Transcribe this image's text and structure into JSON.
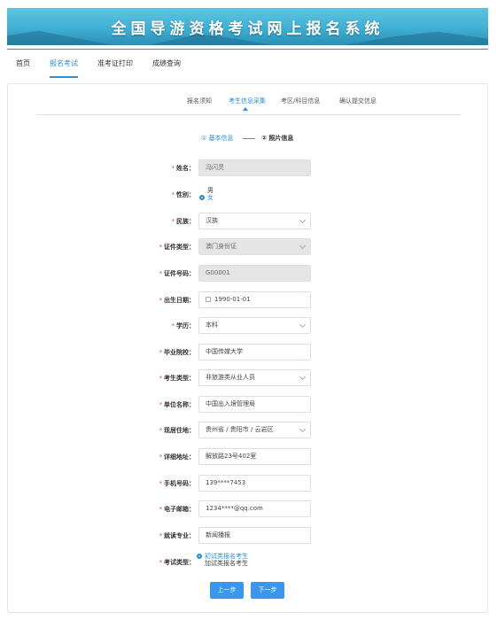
{
  "banner": {
    "title": "全国导游资格考试网上报名系统"
  },
  "topnav": [
    "首页",
    "报名考试",
    "准考证打印",
    "成绩查询"
  ],
  "steptabs": [
    "报名须知",
    "考生信息采集",
    "考区/科目信息",
    "确认提交信息"
  ],
  "substeps": {
    "step1": "① 基本信息",
    "step2": "② 照片信息"
  },
  "form": {
    "name": {
      "label": "姓名：",
      "value": "冯闪灵"
    },
    "gender": {
      "label": "性别：",
      "options": [
        "男",
        "女"
      ]
    },
    "ethnicity": {
      "label": "民族：",
      "value": "汉族"
    },
    "id_type": {
      "label": "证件类型：",
      "value": "澳门身份证"
    },
    "id_number": {
      "label": "证件号码：",
      "value": "G00001"
    },
    "birth_date": {
      "label": "出生日期：",
      "value": "1990-01-01"
    },
    "education": {
      "label": "学历：",
      "value": "本科"
    },
    "school": {
      "label": "毕业院校：",
      "value": "中国传媒大学"
    },
    "cand_type": {
      "label": "考生类型：",
      "value": "非旅游类从业人员"
    },
    "employer": {
      "label": "单位名称：",
      "value": "中国出入境管理局"
    },
    "residence": {
      "label": "现居住地：",
      "value": "贵州省 / 贵阳市 / 云岩区"
    },
    "address": {
      "label": "详细地址：",
      "value": "解放路23号402室"
    },
    "phone": {
      "label": "手机号码：",
      "value": "139****7453"
    },
    "email": {
      "label": "电子邮箱：",
      "value": "1234****@qq.com"
    },
    "major": {
      "label": "就读专业：",
      "value": "新闻播报"
    },
    "exam_type": {
      "label": "考试类型：",
      "options": [
        "初试类报名考生",
        "加试类报名考生"
      ]
    }
  },
  "buttons": {
    "prev": "上一步",
    "next": "下一步"
  },
  "colors": {
    "accent": "#2a8fd6",
    "button": "#3a96ee",
    "required": "#e84a4a"
  }
}
